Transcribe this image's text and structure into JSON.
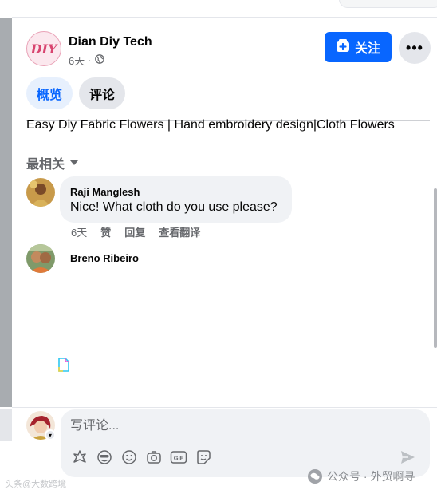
{
  "post": {
    "page_name": "Dian Diy Tech",
    "time": "6天",
    "avatar_text": "DIY",
    "follow_label": "关注",
    "more_label": "•••",
    "tabs": [
      {
        "label": "概览",
        "active": true
      },
      {
        "label": "评论",
        "active": false
      }
    ],
    "text": "Easy Diy Fabric Flowers | Hand embroidery design|Cloth Flowers"
  },
  "sort": {
    "label": "最相关"
  },
  "comments": [
    {
      "author": "Raji Manglesh",
      "text": "Nice! What cloth do you use please?",
      "time": "6天",
      "like": "赞",
      "reply": "回复",
      "translate": "查看翻译"
    },
    {
      "author": "Breno Ribeiro"
    }
  ],
  "composer": {
    "placeholder": "写评论...",
    "tools": [
      "avatar-sticker-icon",
      "emoji-face-icon",
      "smiley-icon",
      "camera-icon",
      "gif-icon",
      "sticker-icon"
    ],
    "send_icon": "send-icon"
  },
  "watermark": {
    "left": "头条@大数跨境",
    "right": "公众号 · 外贸啊寻"
  },
  "colors": {
    "accent": "#0866ff",
    "tab_active_bg": "#e7f0fd",
    "secondary_text": "#65676b",
    "bubble_bg": "#f0f2f5"
  }
}
